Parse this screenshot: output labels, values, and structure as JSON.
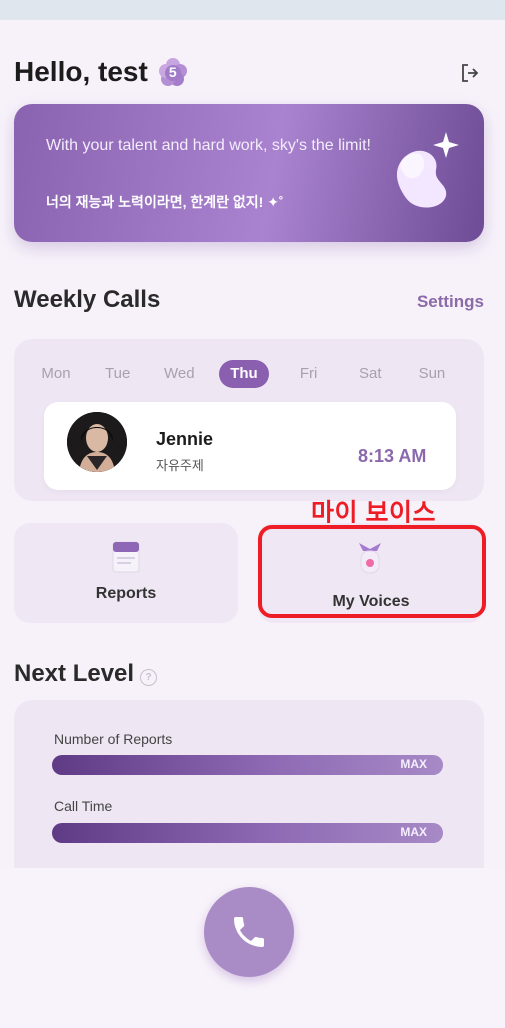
{
  "header": {
    "greeting": "Hello, test",
    "level_badge": "5",
    "logout_icon": "logout-icon"
  },
  "banner": {
    "text_en": "With your talent and hard work, sky's the limit!",
    "text_kr": "너의 재능과 노력이라면, 한계란 없지! ✦˚"
  },
  "weekly": {
    "title": "Weekly Calls",
    "settings_label": "Settings",
    "days": [
      "Mon",
      "Tue",
      "Wed",
      "Thu",
      "Fri",
      "Sat",
      "Sun"
    ],
    "selected_day": "Thu",
    "call": {
      "name": "Jennie",
      "topic": "자유주제",
      "time": "8:13 AM"
    }
  },
  "annotation": {
    "label": "마이 보이스",
    "color": "#ee1c25"
  },
  "tiles": {
    "reports_label": "Reports",
    "my_voices_label": "My Voices"
  },
  "next_level": {
    "title": "Next Level",
    "help_icon": "?",
    "metrics": [
      {
        "label": "Number of Reports",
        "status": "MAX",
        "progress": 1.0
      },
      {
        "label": "Call Time",
        "status": "MAX",
        "progress": 1.0
      }
    ]
  },
  "colors": {
    "accent": "#8a5fb0",
    "time_accent": "#8b68ad",
    "call_button": "#a98bc6"
  }
}
